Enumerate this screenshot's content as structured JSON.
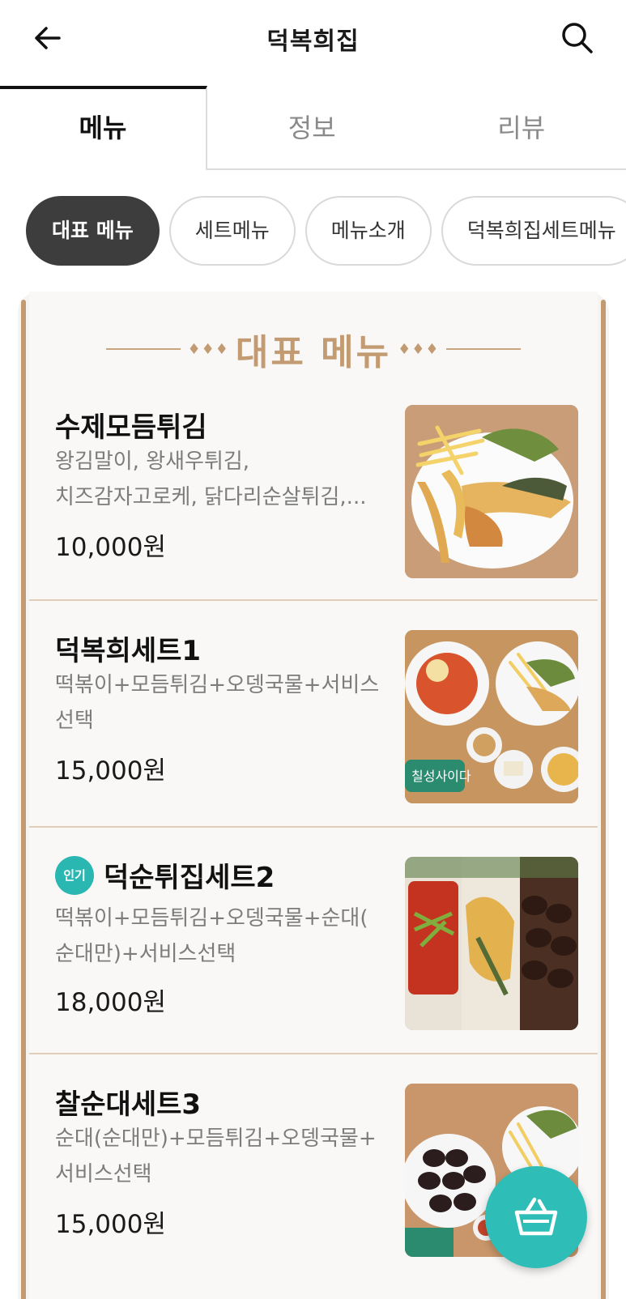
{
  "header": {
    "title": "덕복희집",
    "back_icon": "arrow-left-icon",
    "search_icon": "search-icon"
  },
  "tabs": [
    {
      "label": "메뉴",
      "active": true
    },
    {
      "label": "정보",
      "active": false
    },
    {
      "label": "리뷰",
      "active": false
    }
  ],
  "categories": [
    {
      "label": "대표 메뉴",
      "active": true
    },
    {
      "label": "세트메뉴",
      "active": false
    },
    {
      "label": "메뉴소개",
      "active": false
    },
    {
      "label": "덕복희집세트메뉴",
      "active": false
    }
  ],
  "section": {
    "title": "대표 메뉴",
    "deco_left": "♦♦♦",
    "deco_right": "♦♦♦"
  },
  "items": [
    {
      "name": "수제모듬튀김",
      "desc_line1": "왕김말이, 왕새우튀김,",
      "desc_line2": "치즈감자고로케, 닭다리순살튀김,...",
      "price": "10,000원",
      "badge": ""
    },
    {
      "name": "덕복희세트1",
      "desc_line1": "떡볶이+모듬튀김+오뎅국물+서비스",
      "desc_line2": "선택",
      "price": "15,000원",
      "badge": ""
    },
    {
      "name": "덕순튀집세트2",
      "desc_line1": "떡볶이+모듬튀김+오뎅국물+순대(",
      "desc_line2": "순대만)+서비스선택",
      "price": "18,000원",
      "badge": "인기"
    },
    {
      "name": "찰순대세트3",
      "desc_line1": "순대(순대만)+모듬튀김+오뎅국물+",
      "desc_line2": "서비스선택",
      "price": "15,000원",
      "badge": ""
    }
  ],
  "cart": {
    "icon": "shopping-basket-icon"
  },
  "colors": {
    "accent_teal": "#2fbdb8",
    "gold": "#c39b72",
    "chip_active": "#3d3d3d"
  }
}
